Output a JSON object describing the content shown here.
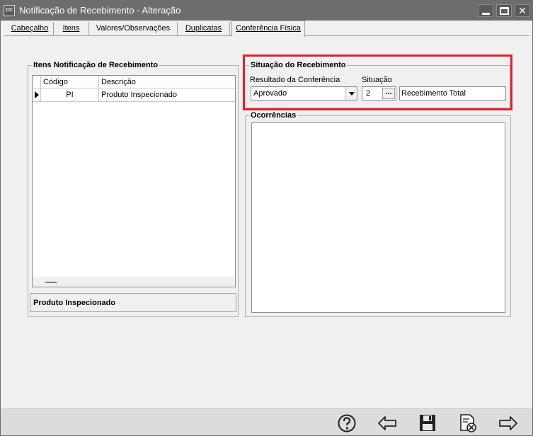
{
  "window": {
    "icon_text": "CC",
    "title": "Notificação de Recebimento - Alteração"
  },
  "tabs": [
    {
      "label": "Cabeçalho",
      "selected": false
    },
    {
      "label": "Itens",
      "selected": false
    },
    {
      "label": "Valores/Observações",
      "selected": false
    },
    {
      "label": "Duplicatas",
      "selected": false
    },
    {
      "label": "Conferência Física",
      "selected": true
    }
  ],
  "items_group": {
    "title": "Itens Notificação de Recebimento",
    "columns": [
      "Código",
      "Descrição"
    ],
    "rows": [
      {
        "codigo": "PI",
        "descricao": "Produto Inspecionado"
      }
    ],
    "status_text": "Produto Inspecionado"
  },
  "situacao_group": {
    "title": "Situação do Recebimento",
    "resultado_label": "Resultado da Conferência",
    "resultado_value": "Aprovado",
    "situacao_label": "Situação",
    "situacao_code": "2",
    "lookup_button_label": "...",
    "situacao_desc": "Recebimento Total",
    "highlight_color": "#e3202a"
  },
  "ocorrencias_group": {
    "title": "Ocorrências",
    "text": ""
  },
  "footer": {
    "buttons": [
      "help-icon",
      "back-arrow-icon",
      "save-icon",
      "cancel-document-icon",
      "next-arrow-icon"
    ]
  }
}
